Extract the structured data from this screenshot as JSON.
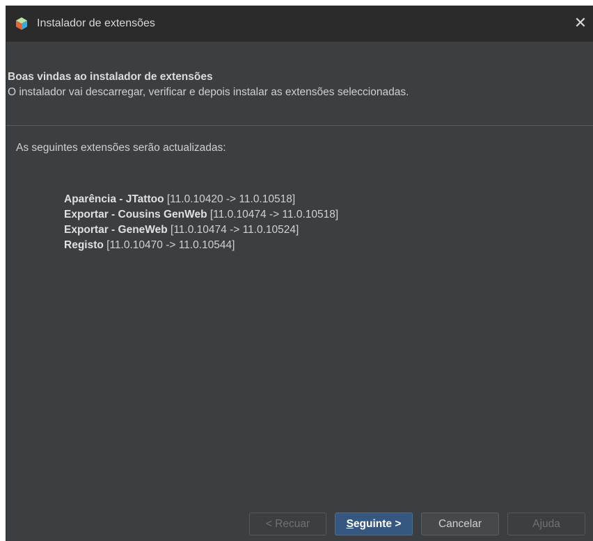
{
  "window": {
    "title": "Instalador de extensões",
    "close_symbol": "✕"
  },
  "header": {
    "title": "Boas vindas ao instalador de extensões",
    "description": "O instalador vai descarregar, verificar e depois instalar as extensões seleccionadas."
  },
  "content": {
    "intro": "As seguintes extensões serão actualizadas:",
    "extensions": [
      {
        "name": "Aparência - JTattoo",
        "versions": "[11.0.10420 -> 11.0.10518]"
      },
      {
        "name": "Exportar - Cousins GenWeb",
        "versions": "[11.0.10474 -> 11.0.10518]"
      },
      {
        "name": "Exportar - GeneWeb",
        "versions": "[11.0.10474 -> 11.0.10524]"
      },
      {
        "name": "Registo",
        "versions": "[11.0.10470 -> 11.0.10544]"
      }
    ]
  },
  "buttons": {
    "back": "< Recuar",
    "next_mnemonic": "S",
    "next_rest": "eguinte >",
    "cancel": "Cancelar",
    "help": "Ajuda"
  },
  "icons": {
    "app": "app-cube-icon",
    "close": "close-icon"
  },
  "colors": {
    "background": "#3c3f41",
    "titlebar": "#2b2b2b",
    "primary_button": "#365880"
  }
}
